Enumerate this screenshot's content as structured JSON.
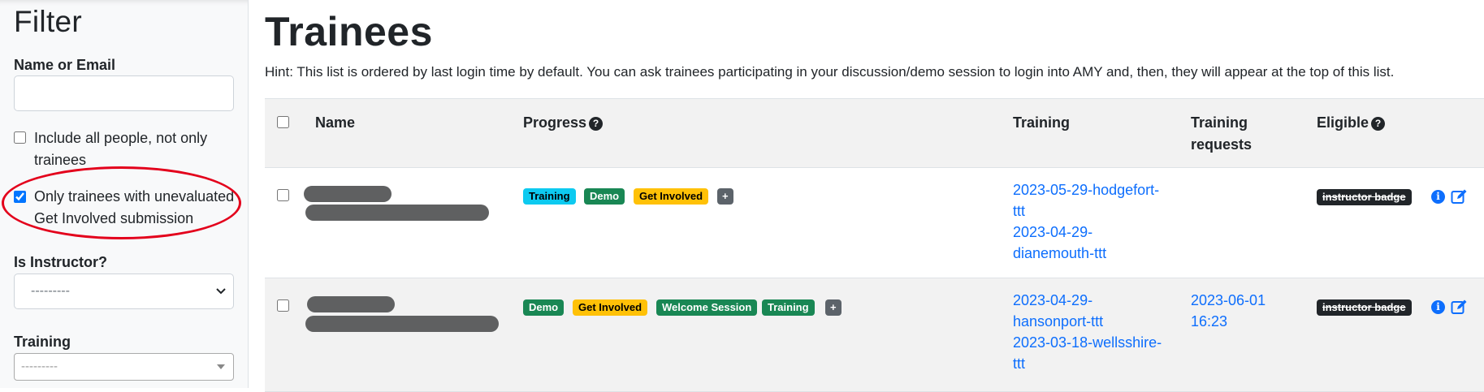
{
  "sidebar": {
    "title": "Filter",
    "name_email_label": "Name or Email",
    "name_email_value": "",
    "include_all_label": "Include all people, not only trainees",
    "include_all_checked": false,
    "only_unevaluated_label": "Only trainees with unevaluated Get Involved submission",
    "only_unevaluated_checked": true,
    "is_instructor_label": "Is Instructor?",
    "is_instructor_value": "---------",
    "training_label": "Training",
    "training_value": "---------"
  },
  "main": {
    "title": "Trainees",
    "hint": "Hint: This list is ordered by last login time by default. You can ask trainees participating in your discussion/demo session to login into AMY and, then, they will appear at the top of this list.",
    "columns": {
      "name": "Name",
      "progress": "Progress",
      "training": "Training",
      "training_requests": "Training requests",
      "eligible": "Eligible"
    },
    "rows": [
      {
        "progress": [
          "Training",
          "Demo",
          "Get Involved",
          "+"
        ],
        "trainings": [
          "2023-05-29-hodgefort-ttt",
          "2023-04-29-dianemouth-ttt"
        ],
        "training_request": "",
        "eligible": "instructor badge"
      },
      {
        "progress": [
          "Demo",
          "Get Involved",
          "Welcome Session",
          "Training",
          "+"
        ],
        "trainings": [
          "2023-04-29-hansonport-ttt",
          "2023-03-18-wellsshire-ttt"
        ],
        "training_request": "2023-06-01 16:23",
        "eligible": "instructor badge"
      }
    ]
  },
  "colors": {
    "link": "#0d6efd",
    "badge_training_row1": "#0dcaf0",
    "badge_green": "#198754",
    "badge_yellow": "#ffc107",
    "badge_gray": "#5c636a",
    "highlight": "#e3001b"
  }
}
